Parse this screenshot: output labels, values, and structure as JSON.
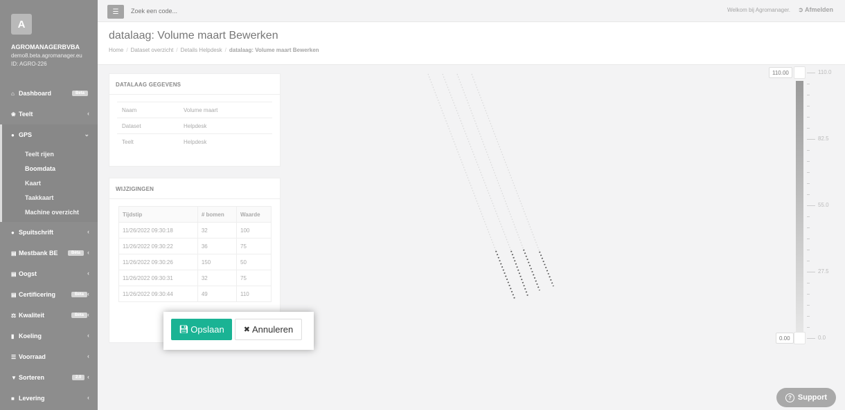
{
  "sidebar": {
    "avatar_letter": "A",
    "company": "AGROMANAGERBVBA",
    "email": "demo8.beta.agromanager.eu",
    "account_id": "ID: AGRO-226",
    "items": [
      {
        "label": "Dashboard",
        "icon": "home-icon",
        "badge": "Beta"
      },
      {
        "label": "Teelt",
        "icon": "leaf-icon"
      },
      {
        "label": "GPS",
        "icon": "map-marker-icon"
      },
      {
        "label": "Spuitschrift",
        "icon": "droplet-icon"
      },
      {
        "label": "Mestbank BE",
        "icon": "bank-icon",
        "badge": "Bèta"
      },
      {
        "label": "Oogst",
        "icon": "basket-icon"
      },
      {
        "label": "Certificering",
        "icon": "certificate-icon",
        "badge": "Bèta"
      },
      {
        "label": "Kwaliteit",
        "icon": "balance-icon",
        "badge": "Bèta"
      },
      {
        "label": "Koeling",
        "icon": "thermometer-icon"
      },
      {
        "label": "Voorraad",
        "icon": "list-icon"
      },
      {
        "label": "Sorteren",
        "icon": "filter-icon",
        "badge": "2.0"
      },
      {
        "label": "Levering",
        "icon": "truck-icon"
      }
    ],
    "gps_sub": [
      "Teelt rijen",
      "Boomdata",
      "Kaart",
      "Taakkaart",
      "Machine overzicht"
    ]
  },
  "topbar": {
    "search_placeholder": "Zoek een code...",
    "welcome": "Welkom bij Agromanager.",
    "logout": "Afmelden"
  },
  "header": {
    "title": "datalaag: Volume maart Bewerken",
    "breadcrumb": [
      "Home",
      "Dataset overzicht",
      "Details Helpdesk",
      "datalaag: Volume maart Bewerken"
    ]
  },
  "details": {
    "title": "DATALAAG GEGEVENS",
    "rows": [
      {
        "key": "Naam",
        "value": "Volume maart"
      },
      {
        "key": "Dataset",
        "value": "Helpdesk"
      },
      {
        "key": "Teelt",
        "value": "Helpdesk"
      }
    ]
  },
  "changes": {
    "title": "WIJZIGINGEN",
    "headers": [
      "Tijdstip",
      "# bomen",
      "Waarde"
    ],
    "rows": [
      [
        "11/26/2022 09:30:18",
        "32",
        "100"
      ],
      [
        "11/26/2022 09:30:22",
        "36",
        "75"
      ],
      [
        "11/26/2022 09:30:26",
        "150",
        "50"
      ],
      [
        "11/26/2022 09:30:31",
        "32",
        "75"
      ],
      [
        "11/26/2022 09:30:44",
        "49",
        "110"
      ]
    ]
  },
  "actions": {
    "save": "Opslaan",
    "cancel": "Annuleren"
  },
  "slider": {
    "max_value": "110.00",
    "min_value": "0.00",
    "scale": [
      "110.0",
      "82.5",
      "55.0",
      "27.5",
      "0.0"
    ]
  },
  "support": {
    "label": "Support"
  },
  "colors": {
    "sidebar": "#8d8d8d",
    "primary": "#1ab394"
  }
}
